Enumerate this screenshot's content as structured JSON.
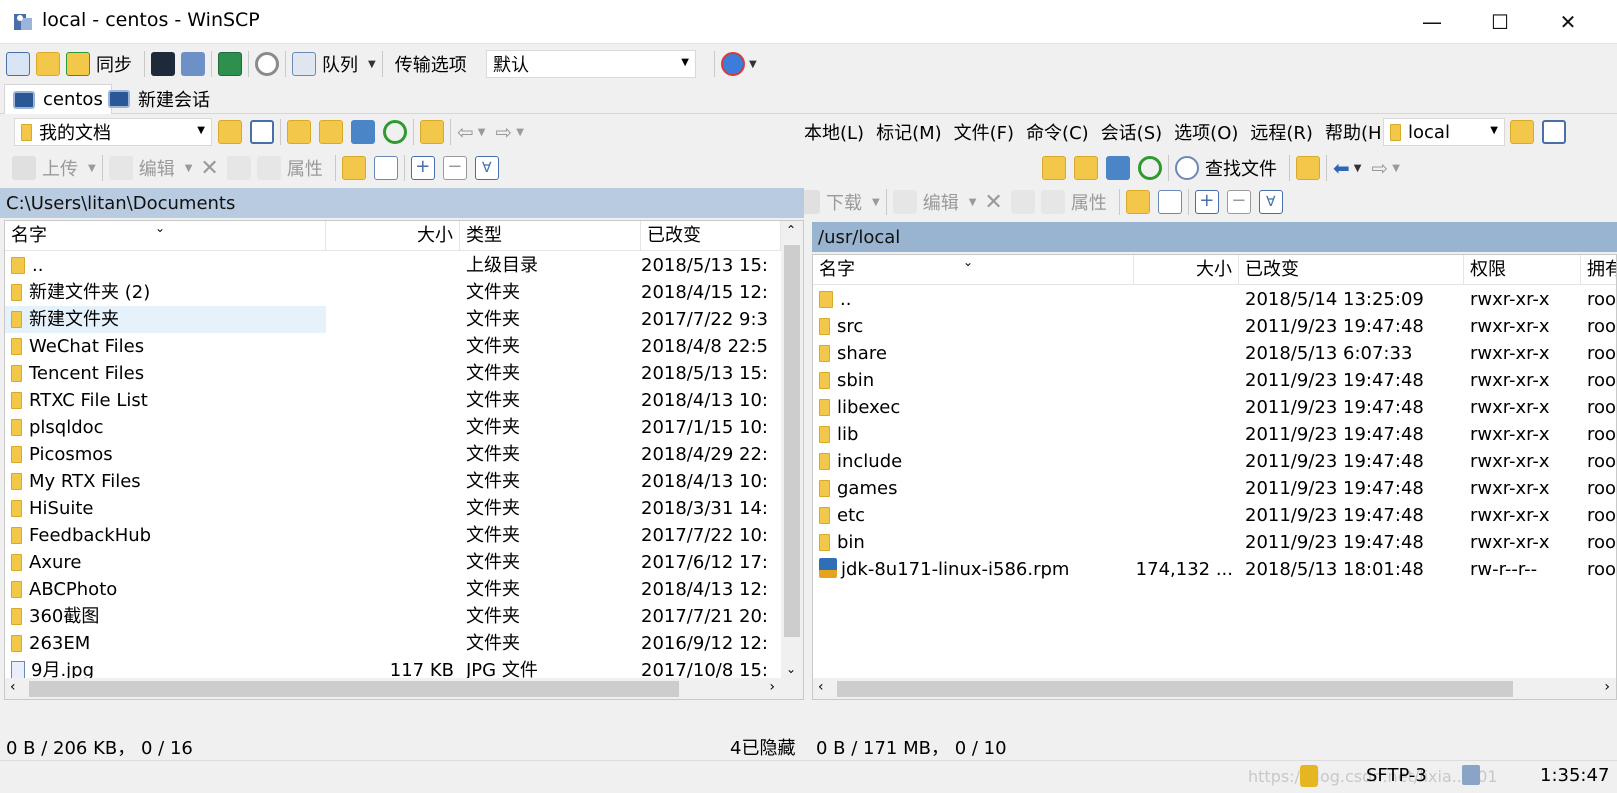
{
  "window": {
    "title": "local - centos - WinSCP",
    "minimize": "—",
    "maximize": "☐",
    "close": "✕"
  },
  "toolbar1": {
    "sync_label": "同步",
    "queue_label": "队列",
    "transfer_options_label": "传输选项",
    "transfer_preset": "默认"
  },
  "tabs": [
    {
      "label": "centos"
    },
    {
      "label": "新建会话"
    }
  ],
  "local": {
    "drive_combo": "我的文档",
    "upload_label": "上传",
    "edit_label": "编辑",
    "properties_label": "属性",
    "path": "C:\\Users\\litan\\Documents",
    "columns": {
      "name": "名字",
      "size": "大小",
      "type": "类型",
      "changed": "已改变"
    },
    "files": [
      {
        "name": "..",
        "size": "",
        "type": "上级目录",
        "changed": "2018/5/13  15:"
      },
      {
        "name": "新建文件夹 (2)",
        "size": "",
        "type": "文件夹",
        "changed": "2018/4/15  12:"
      },
      {
        "name": "新建文件夹",
        "size": "",
        "type": "文件夹",
        "changed": "2017/7/22  9:3"
      },
      {
        "name": "WeChat Files",
        "size": "",
        "type": "文件夹",
        "changed": "2018/4/8  22:5"
      },
      {
        "name": "Tencent Files",
        "size": "",
        "type": "文件夹",
        "changed": "2018/5/13  15:"
      },
      {
        "name": "RTXC File List",
        "size": "",
        "type": "文件夹",
        "changed": "2018/4/13  10:"
      },
      {
        "name": "plsqldoc",
        "size": "",
        "type": "文件夹",
        "changed": "2017/1/15  10:"
      },
      {
        "name": "Picosmos",
        "size": "",
        "type": "文件夹",
        "changed": "2018/4/29  22:"
      },
      {
        "name": "My RTX Files",
        "size": "",
        "type": "文件夹",
        "changed": "2018/4/13  10:"
      },
      {
        "name": "HiSuite",
        "size": "",
        "type": "文件夹",
        "changed": "2018/3/31  14:"
      },
      {
        "name": "FeedbackHub",
        "size": "",
        "type": "文件夹",
        "changed": "2017/7/22  10:"
      },
      {
        "name": "Axure",
        "size": "",
        "type": "文件夹",
        "changed": "2017/6/12  17:"
      },
      {
        "name": "ABCPhoto",
        "size": "",
        "type": "文件夹",
        "changed": "2018/4/13  12:"
      },
      {
        "name": "360截图",
        "size": "",
        "type": "文件夹",
        "changed": "2017/7/21  20:"
      },
      {
        "name": "263EM",
        "size": "",
        "type": "文件夹",
        "changed": "2016/9/12  12:"
      },
      {
        "name": "9月.jpg",
        "size": "117 KB",
        "type": "JPG 文件",
        "changed": "2017/10/8  15:"
      }
    ],
    "status_left": "0 B / 206 KB， 0 / 16",
    "status_right": "4已隐藏"
  },
  "menu": {
    "items": [
      "本地(L)",
      "标记(M)",
      "文件(F)",
      "命令(C)",
      "会话(S)",
      "选项(O)",
      "远程(R)",
      "帮助(H)"
    ]
  },
  "remote": {
    "dir_combo": "local",
    "find_files_label": "查找文件",
    "download_label": "下载",
    "edit_label": "编辑",
    "properties_label": "属性",
    "path": "/usr/local",
    "columns": {
      "name": "名字",
      "size": "大小",
      "changed": "已改变",
      "rights": "权限",
      "owner": "拥有"
    },
    "files": [
      {
        "name": "..",
        "size": "",
        "changed": "2018/5/14 13:25:09",
        "rights": "rwxr-xr-x",
        "owner": "roo"
      },
      {
        "name": "src",
        "size": "",
        "changed": "2011/9/23 19:47:48",
        "rights": "rwxr-xr-x",
        "owner": "roo"
      },
      {
        "name": "share",
        "size": "",
        "changed": "2018/5/13 6:07:33",
        "rights": "rwxr-xr-x",
        "owner": "roo"
      },
      {
        "name": "sbin",
        "size": "",
        "changed": "2011/9/23 19:47:48",
        "rights": "rwxr-xr-x",
        "owner": "roo"
      },
      {
        "name": "libexec",
        "size": "",
        "changed": "2011/9/23 19:47:48",
        "rights": "rwxr-xr-x",
        "owner": "roo"
      },
      {
        "name": "lib",
        "size": "",
        "changed": "2011/9/23 19:47:48",
        "rights": "rwxr-xr-x",
        "owner": "roo"
      },
      {
        "name": "include",
        "size": "",
        "changed": "2011/9/23 19:47:48",
        "rights": "rwxr-xr-x",
        "owner": "roo"
      },
      {
        "name": "games",
        "size": "",
        "changed": "2011/9/23 19:47:48",
        "rights": "rwxr-xr-x",
        "owner": "roo"
      },
      {
        "name": "etc",
        "size": "",
        "changed": "2011/9/23 19:47:48",
        "rights": "rwxr-xr-x",
        "owner": "roo"
      },
      {
        "name": "bin",
        "size": "",
        "changed": "2011/9/23 19:47:48",
        "rights": "rwxr-xr-x",
        "owner": "roo"
      },
      {
        "name": "jdk-8u171-linux-i586.rpm",
        "size": "174,132 ...",
        "changed": "2018/5/13 18:01:48",
        "rights": "rw-r--r--",
        "owner": "roo"
      }
    ],
    "status_left": "0 B / 171 MB， 0 / 10"
  },
  "statusbar": {
    "watermark": "https://blog.csdn.net/lixia...101",
    "protocol": "SFTP-3",
    "time": "1:35:47"
  }
}
